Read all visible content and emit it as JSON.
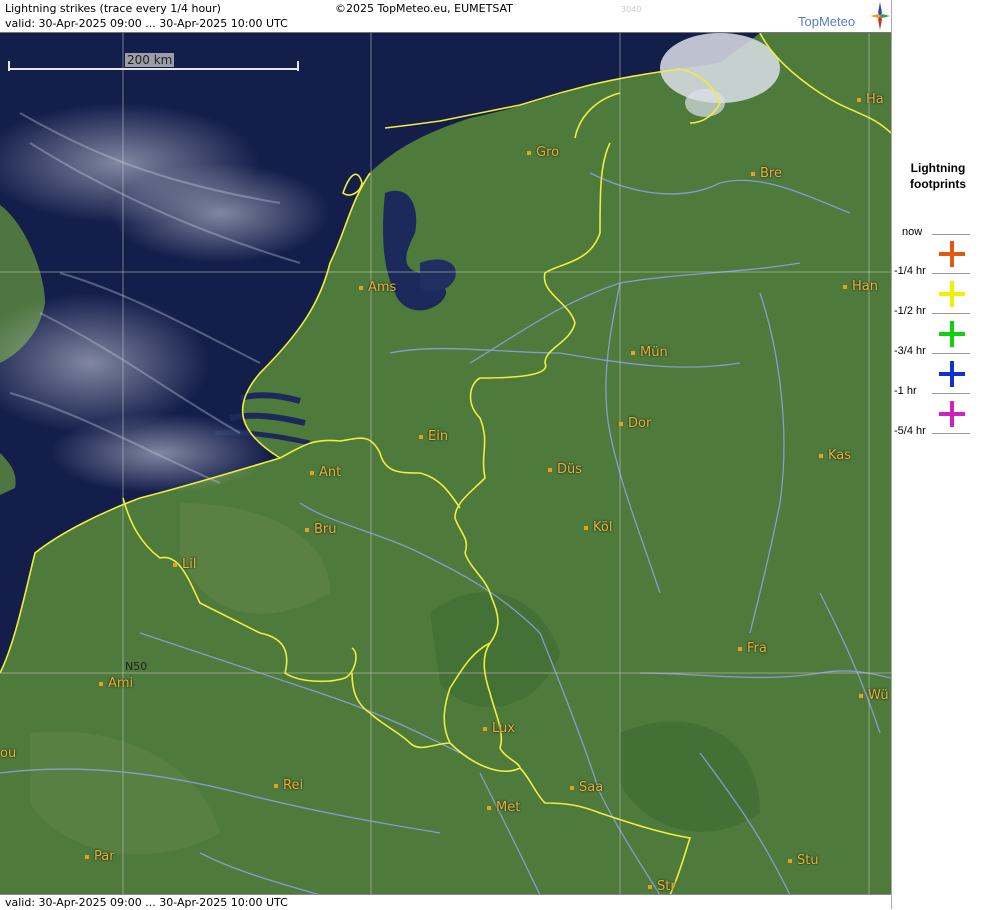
{
  "header": {
    "title": "Lightning strikes (trace every 1/4 hour)",
    "copyright": "©2025 TopMeteo.eu, EUMETSAT",
    "code": "3040",
    "valid": "valid:  30-Apr-2025 09:00 ... 30-Apr-2025 10:00 UTC",
    "brand": "TopMeteo"
  },
  "footer": {
    "valid": "valid:  30-Apr-2025 09:00 ... 30-Apr-2025 10:00 UTC"
  },
  "scale": {
    "label": "200 km"
  },
  "gridlabel": "N50",
  "legend": {
    "title_line1": "Lightning",
    "title_line2": "footprints",
    "items": [
      {
        "label": "now",
        "color": ""
      },
      {
        "label": "-1/4 hr",
        "color": "#e05a10"
      },
      {
        "label": "-1/2 hr",
        "color": "#f0f000"
      },
      {
        "label": "-3/4 hr",
        "color": "#10d010"
      },
      {
        "label": "-1 hr",
        "color": "#1030d0"
      },
      {
        "label": "-5/4 hr",
        "color": "#d020c0"
      }
    ]
  },
  "cities": {
    "ha": "Ha",
    "gro": "Gro",
    "bre": "Bre",
    "ams": "Ams",
    "han": "Han",
    "mun": "Mün",
    "dor": "Dor",
    "ein": "Ein",
    "ant": "Ant",
    "dus": "Düs",
    "kas": "Kas",
    "bru": "Bru",
    "kol": "Köl",
    "lil": "Lil",
    "fra": "Fra",
    "ami": "Ami",
    "wu": "Wü",
    "lux": "Lux",
    "ou": "ou",
    "rei": "Rei",
    "saa": "Saa",
    "met": "Met",
    "par": "Par",
    "stu": "Stu",
    "str": "Str"
  },
  "colors": {
    "sea": "#141e4a",
    "land": "#4e7a3c",
    "border": "#f0ec40",
    "river": "#8d9fe0",
    "city": "#e8b23a"
  }
}
